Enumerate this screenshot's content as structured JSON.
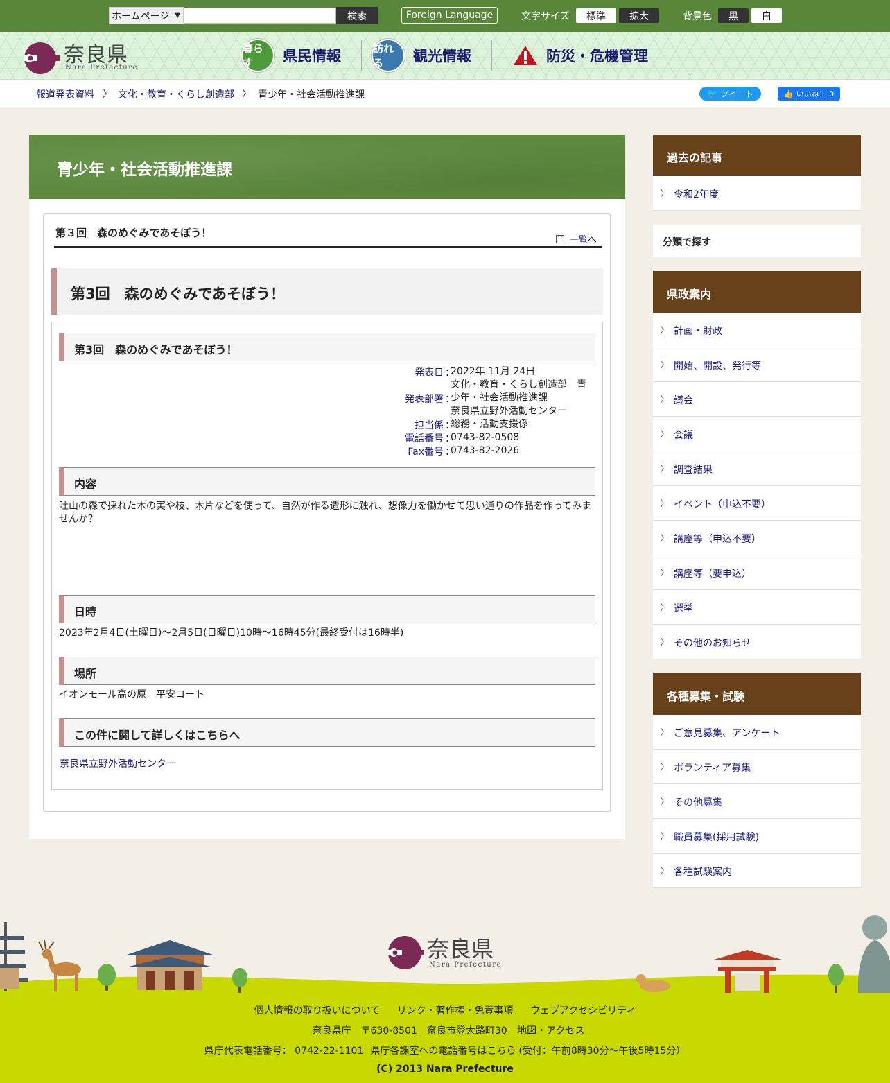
{
  "topbar": {
    "site_select": "ホームページ",
    "search_button": "検索",
    "foreign_language": "Foreign Language",
    "font_size_label": "文字サイズ",
    "font_standard": "標準",
    "font_large": "拡大",
    "bg_label": "背景色",
    "bg_black": "黒",
    "bg_white": "白"
  },
  "header": {
    "logo_text": "奈良県",
    "logo_sub": "Nara Prefecture",
    "nav": [
      {
        "icon_text": "暮らす",
        "label": "県民情報",
        "color": "#4d9a3a"
      },
      {
        "icon_text": "訪れる",
        "label": "観光情報",
        "color": "#3a78b0"
      },
      {
        "icon_text": "!",
        "label": "防災・危機管理",
        "color": "#c0141e"
      }
    ]
  },
  "breadcrumb": {
    "items": [
      "報道発表資料",
      "文化・教育・くらし創造部",
      "青少年・社会活動推進課"
    ],
    "tweet": "ツイート",
    "like": "いいね！ 0"
  },
  "main": {
    "page_title": "青少年・社会活動推進課",
    "article_top_title": "第３回　森のめぐみであそぼう！",
    "back_link": "一覧へ",
    "article_title": "第3回　森のめぐみであそぼう！",
    "section_title": "第3回　森のめぐみであそぼう！",
    "meta": {
      "date_label": "発表日",
      "date": "2022年 11月 24日",
      "dept_label": "発表部署",
      "dept_lines": [
        "文化・教育・くらし創造部　青",
        "少年・社会活動推進課",
        "奈良県立野外活動センター"
      ],
      "staff_label": "担当係",
      "staff": "総務・活動支援係",
      "tel_label": "電話番号",
      "tel": "0743-82-0508",
      "fax_label": "Fax番号",
      "fax": "0743-82-2026"
    },
    "content_heading": "内容",
    "content_lines": [
      "吐山の森で採れた木の実や枝、木片などを使って、自然が作る造形に触れ、想像力を働かせて思い通りの作品を作ってみま",
      "せんか？"
    ],
    "datetime_heading": "日時",
    "datetime": "2023年2月4日(土曜日)～2月5日(日曜日)10時～16時45分(最終受付は16時半)",
    "place_heading": "場所",
    "place": "イオンモール高の原　平安コート",
    "detail_heading": "この件に関して詳しくはこちらへ",
    "detail_link": "奈良県立野外活動センター"
  },
  "sidebar": {
    "past_heading": "過去の記事",
    "past_items": [
      "令和2年度"
    ],
    "category_search": "分類で探す",
    "gov_heading": "県政案内",
    "gov_items": [
      "計画・財政",
      "開始、開設、発行等",
      "議会",
      "会議",
      "調査結果",
      "イベント（申込不要）",
      "講座等（申込不要）",
      "講座等（要申込）",
      "選挙",
      "その他のお知らせ"
    ],
    "recruit_heading": "各種募集・試験",
    "recruit_items": [
      "ご意見募集、アンケート",
      "ボランティア募集",
      "その他募集",
      "職員募集(採用試験)",
      "各種試験案内"
    ]
  },
  "footer": {
    "logo_text": "奈良県",
    "logo_sub": "Nara Prefecture",
    "links": [
      "個人情報の取り扱いについて",
      "リンク・著作権・免責事項",
      "ウェブアクセシビリティ"
    ],
    "address": "奈良県庁　〒630-8501　奈良市登大路町30",
    "map_link": "地図・アクセス",
    "tel_label": "県庁代表電話番号： 0742-22-1101",
    "tel_link": "県庁各課室への電話番号はこちら",
    "hours": "(受付：午前8時30分～午後5時15分）",
    "copyright": "(C) 2013 Nara Prefecture"
  }
}
